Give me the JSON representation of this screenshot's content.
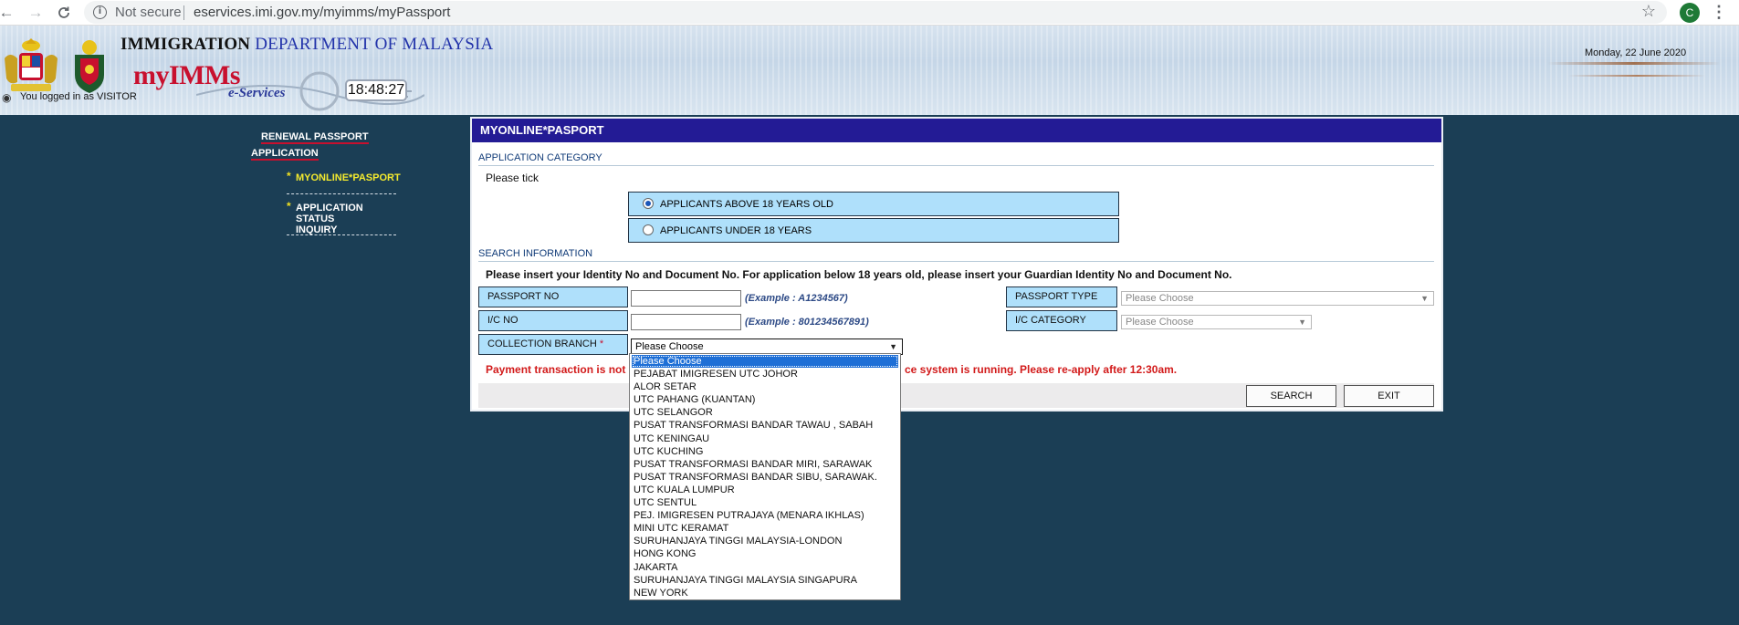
{
  "browser": {
    "security_label": "Not secure",
    "url": "eservices.imi.gov.my/myimms/myPassport",
    "profile_initial": "C"
  },
  "header": {
    "title_part1": "IMMIGRATION",
    "title_part2": "DEPARTMENT OF MALAYSIA",
    "brand": "myIMMs",
    "subbrand": "e-Services",
    "clock": "18:48:27",
    "login_status": "You logged in as VISITOR",
    "date": "Monday, 22 June 2020"
  },
  "sidebar": {
    "heading_line1": "RENEWAL PASSPORT",
    "heading_line2": "APPLICATION",
    "items": [
      {
        "label": "MYONLINE*PASPORT"
      },
      {
        "label": "APPLICATION STATUS INQUIRY"
      }
    ]
  },
  "panel": {
    "title": "MYONLINE*PASPORT",
    "category_heading": "APPLICATION CATEGORY",
    "category_hint": "Please tick",
    "options": [
      {
        "label": "APPLICANTS ABOVE 18 YEARS OLD",
        "checked": true
      },
      {
        "label": "APPLICANTS UNDER 18 YEARS",
        "checked": false
      }
    ],
    "search_heading": "SEARCH INFORMATION",
    "search_hint": "Please insert your Identity No and Document No. For application below 18 years old, please insert your Guardian Identity No and Document No.",
    "fields": {
      "passport_no_label": "PASSPORT NO",
      "passport_no_value": "",
      "passport_no_example": "(Example : A1234567)",
      "ic_no_label": "I/C NO",
      "ic_no_value": "",
      "ic_no_example": "(Example : 801234567891)",
      "collection_branch_label": "COLLECTION BRANCH",
      "collection_branch_required": "*",
      "collection_branch_value": "Please Choose",
      "passport_type_label": "PASSPORT TYPE",
      "passport_type_value": "Please Choose",
      "ic_category_label": "I/C CATEGORY",
      "ic_category_value": "Please Choose"
    },
    "warning_left": "Payment transaction is not",
    "warning_right": "ce system is running. Please re-apply after 12:30am.",
    "search_button": "SEARCH",
    "exit_button": "EXIT"
  },
  "branch_dropdown": {
    "selected_index": 0,
    "options": [
      "Please Choose",
      "PEJABAT IMIGRESEN UTC JOHOR",
      "ALOR SETAR",
      "UTC PAHANG (KUANTAN)",
      "UTC SELANGOR",
      "PUSAT TRANSFORMASI BANDAR TAWAU , SABAH",
      "UTC KENINGAU",
      "UTC KUCHING",
      "PUSAT TRANSFORMASI BANDAR MIRI, SARAWAK",
      "PUSAT TRANSFORMASI BANDAR SIBU, SARAWAK.",
      "UTC KUALA LUMPUR",
      "UTC SENTUL",
      "PEJ. IMIGRESEN PUTRAJAYA (MENARA IKHLAS)",
      "MINI UTC KERAMAT",
      "SURUHANJAYA TINGGI MALAYSIA-LONDON",
      "HONG KONG",
      "JAKARTA",
      "SURUHANJAYA TINGGI MALAYSIA SINGAPURA",
      "NEW YORK"
    ]
  },
  "colors": {
    "page_background": "#1b3e55",
    "panel_title_bar": "#231b95",
    "field_label_bg": "#afe0fb",
    "warning_text": "#d21a1a",
    "brand_red": "#c8102e",
    "active_menu": "#f4ea2e"
  },
  "icons": [
    "back-arrow-icon",
    "forward-arrow-icon",
    "reload-icon",
    "info-icon",
    "star-icon",
    "menu-dots-icon",
    "coat-of-arms-icon",
    "immigration-crest-icon",
    "user-icon",
    "chevron-down-icon"
  ]
}
